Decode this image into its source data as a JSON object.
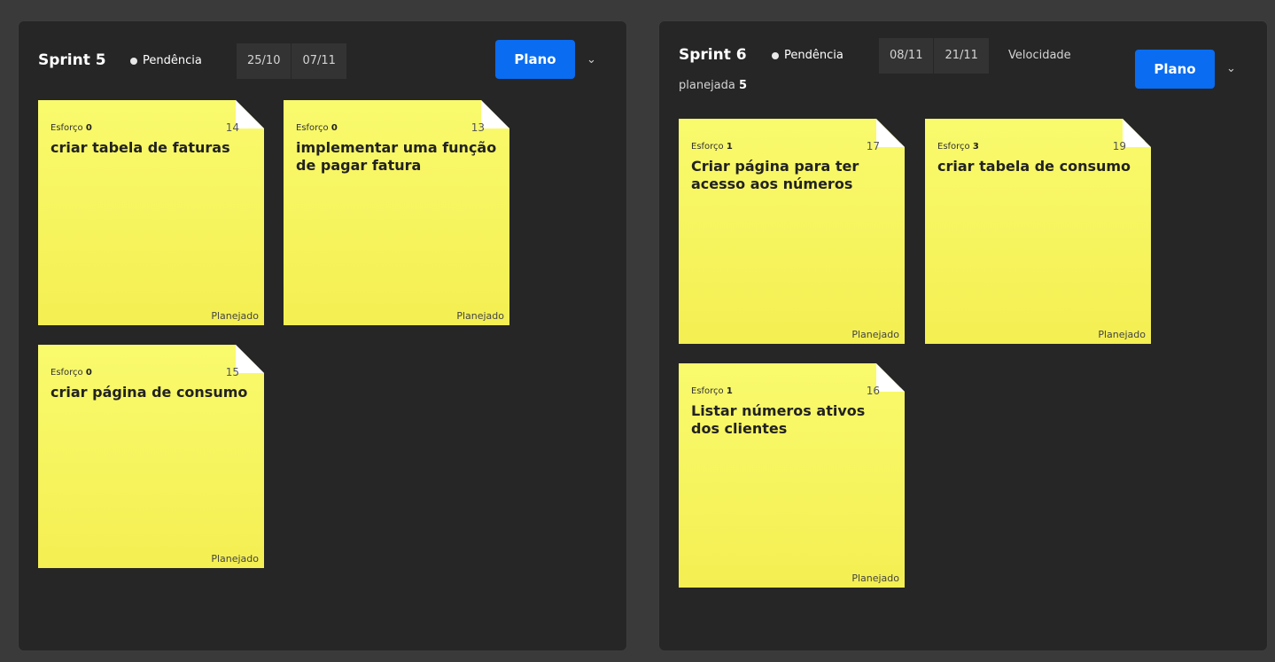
{
  "sprints": [
    {
      "name": "Sprint 5",
      "status": "Pendência",
      "start": "25/10",
      "end": "07/11",
      "velocity_label": "",
      "velocity_value": "",
      "plan_button": "Plano",
      "cards": [
        {
          "effort_label": "Esforço",
          "effort": "0",
          "number": "14",
          "title": "criar tabela de faturas",
          "state": "Planejado"
        },
        {
          "effort_label": "Esforço",
          "effort": "0",
          "number": "13",
          "title": "implementar uma função de pagar fatura",
          "state": "Planejado"
        },
        {
          "effort_label": "Esforço",
          "effort": "0",
          "number": "15",
          "title": "criar página de consumo",
          "state": "Planejado"
        }
      ]
    },
    {
      "name": "Sprint 6",
      "status": "Pendência",
      "start": "08/11",
      "end": "21/11",
      "velocity_label": "Velocidade",
      "velocity_label2": "planejada",
      "velocity_value": "5",
      "plan_button": "Plano",
      "cards": [
        {
          "effort_label": "Esforço",
          "effort": "1",
          "number": "17",
          "title": "Criar página para ter acesso aos números",
          "state": "Planejado"
        },
        {
          "effort_label": "Esforço",
          "effort": "3",
          "number": "19",
          "title": "criar tabela de consumo",
          "state": "Planejado"
        },
        {
          "effort_label": "Esforço",
          "effort": "1",
          "number": "16",
          "title": "Listar números ativos dos clientes",
          "state": "Planejado"
        }
      ]
    }
  ],
  "colors": {
    "background": "#3a3a3a",
    "panel": "#262626",
    "accent": "#0a6cf0",
    "card": "#f6f25d"
  },
  "icons": {
    "dropdown": "chevron-down-icon",
    "status": "status-dot-icon"
  }
}
